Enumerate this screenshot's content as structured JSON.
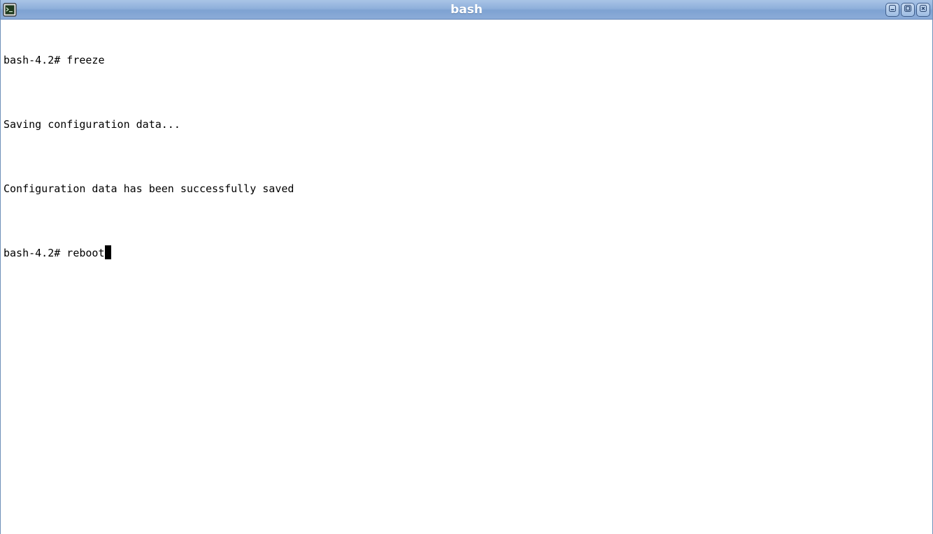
{
  "window": {
    "title": "bash",
    "accent": "#8fb0db",
    "app_icon": "terminal-icon",
    "controls": [
      "minimize-icon",
      "maximize-icon",
      "close-icon"
    ]
  },
  "terminal": {
    "lines": [
      "bash-4.2# freeze",
      "Saving configuration data...",
      "Configuration data has been successfully saved",
      "bash-4.2# reboot"
    ]
  }
}
